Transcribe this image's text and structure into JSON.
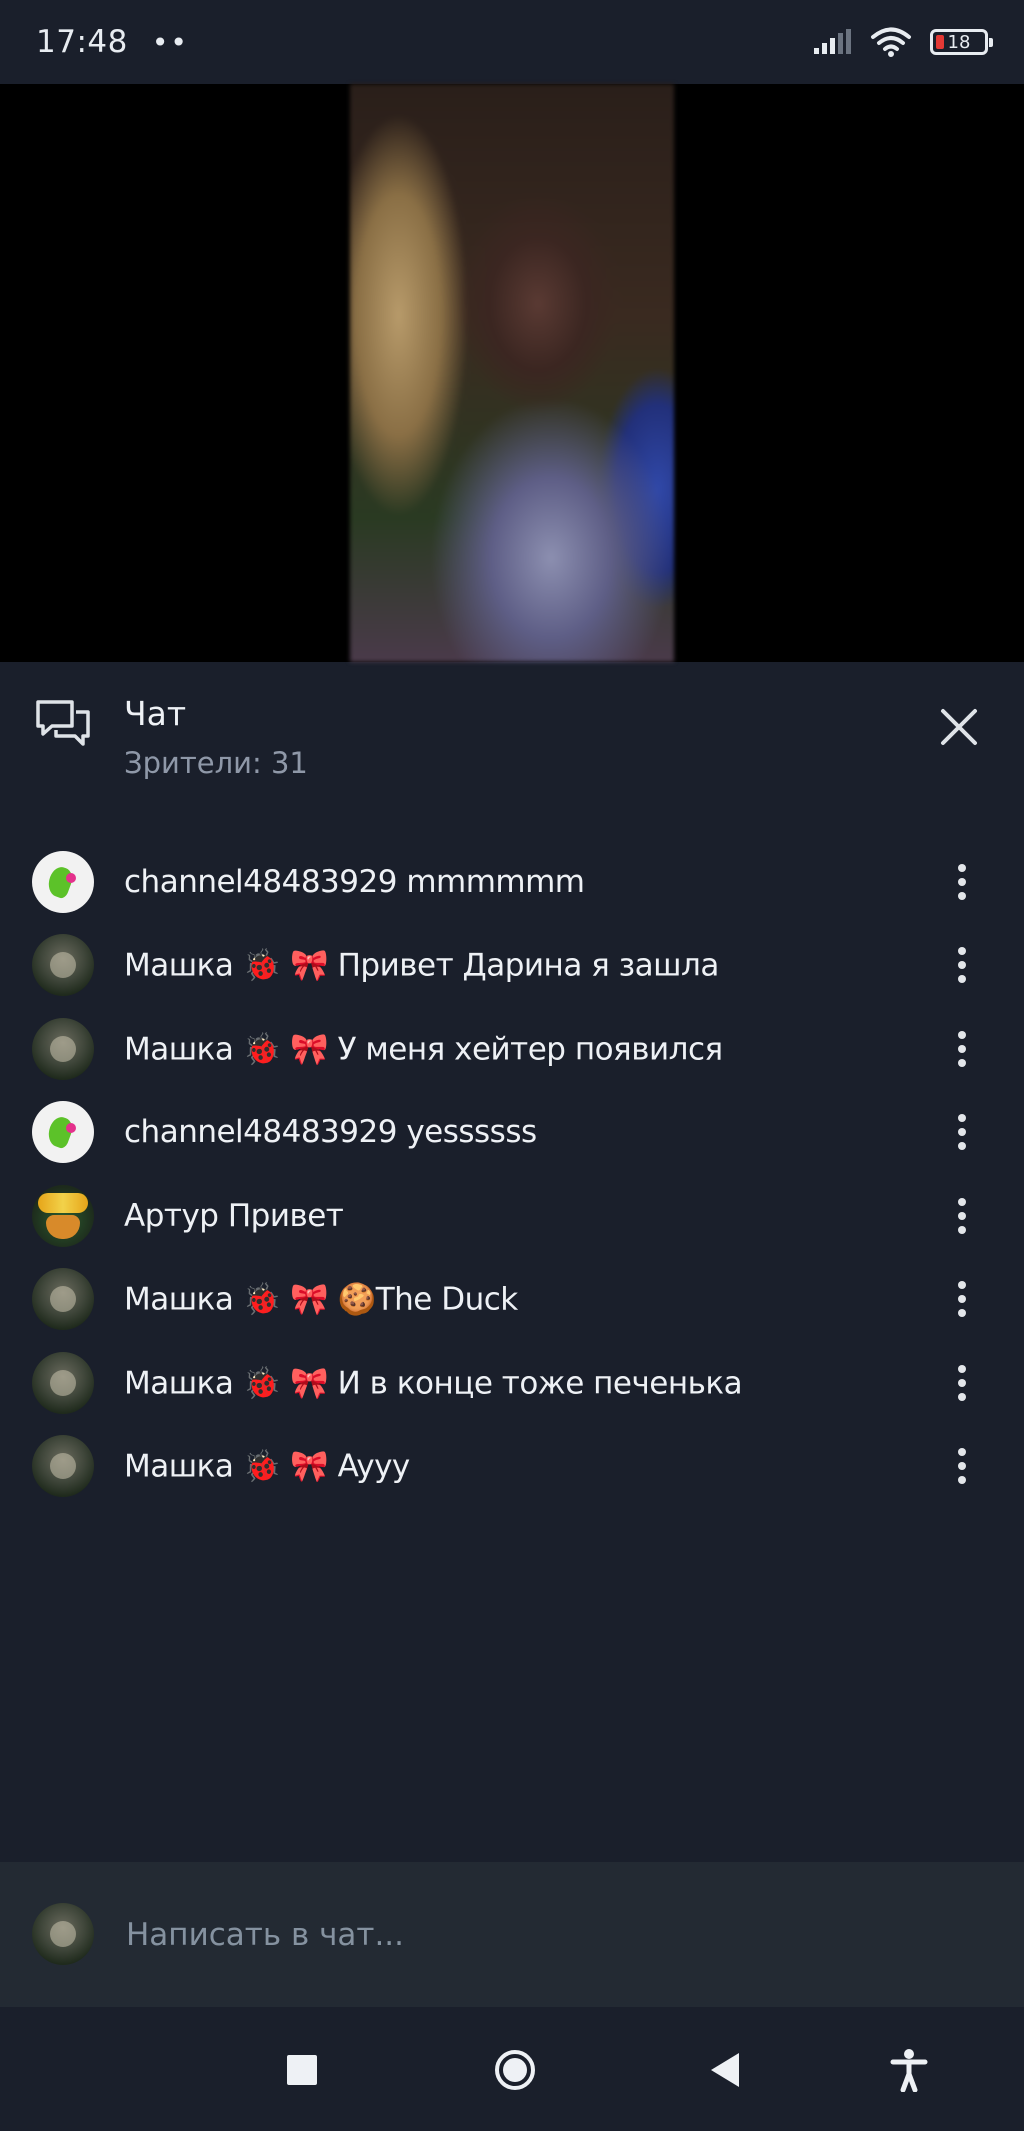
{
  "status_bar": {
    "time": "17:48",
    "dots": "••",
    "battery": "18",
    "icons": [
      "signal-icon",
      "wifi-icon",
      "battery-icon"
    ],
    "battery_low_color": "#e53935"
  },
  "video": {
    "icon": "video-player"
  },
  "chat": {
    "title": "Чат",
    "viewers": "Зрители: 31",
    "icons": {
      "chat": "chat-bubbles-icon",
      "close": "close-icon"
    }
  },
  "messages": [
    {
      "avatar": "parrot",
      "name": "channel48483929",
      "badges": "",
      "text": "mmmmmm"
    },
    {
      "avatar": "cat",
      "name": "Машка",
      "badges": "🐞 🎀",
      "text": "Привет Дарина я зашла"
    },
    {
      "avatar": "cat",
      "name": "Машка",
      "badges": "🐞 🎀",
      "text": "У меня хейтер появился"
    },
    {
      "avatar": "parrot",
      "name": "channel48483929",
      "badges": "",
      "text": "yessssss"
    },
    {
      "avatar": "artur",
      "name": "Артур",
      "badges": "",
      "text": "Привет"
    },
    {
      "avatar": "cat",
      "name": "Машка",
      "badges": "🐞 🎀",
      "text": "🍪The Duck"
    },
    {
      "avatar": "cat",
      "name": "Машка",
      "badges": "🐞 🎀",
      "text": "И в конце тоже печенька"
    },
    {
      "avatar": "cat",
      "name": "Машка",
      "badges": "🐞 🎀",
      "text": "Ayyy"
    }
  ],
  "composer": {
    "placeholder": "Написать в чат..."
  },
  "nav": {
    "icons": [
      "recents-icon",
      "home-icon",
      "back-icon",
      "accessibility-icon"
    ]
  },
  "colors": {
    "background": "#1a1f2b",
    "composer_bg": "#232a33",
    "text": "#eef1f5",
    "muted": "#8f98a8"
  }
}
